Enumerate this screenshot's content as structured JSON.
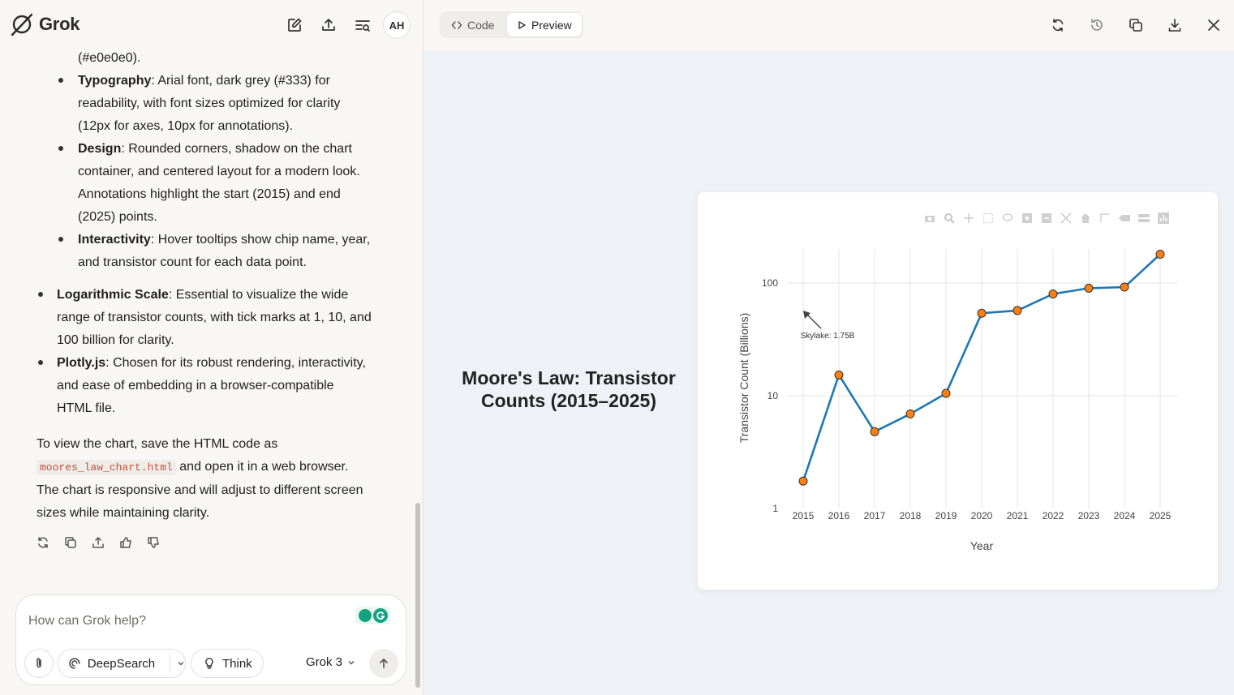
{
  "app": {
    "name": "Grok",
    "avatar_initials": "AH"
  },
  "chat": {
    "partial_top_line": "(#e0e0e0).",
    "sub_bullets": [
      {
        "bold": "Typography",
        "text": ": Arial font, dark grey (#333) for",
        "lines": [
          "readability, with font sizes optimized for clarity",
          "(12px for axes, 10px for annotations)."
        ]
      },
      {
        "bold": "Design",
        "text": ": Rounded corners, shadow on the chart",
        "lines": [
          "container, and centered layout for a modern look.",
          "Annotations highlight the start (2015) and end",
          "(2025) points."
        ]
      },
      {
        "bold": "Interactivity",
        "text": ": Hover tooltips show chip name, year,",
        "lines": [
          "and transistor count for each data point."
        ]
      }
    ],
    "main_bullets": [
      {
        "bold": "Logarithmic Scale",
        "text": ": Essential to visualize the wide",
        "lines": [
          "range of transistor counts, with tick marks at 1, 10, and",
          "100 billion for clarity."
        ]
      },
      {
        "bold": "Plotly.js",
        "text": ": Chosen for its robust rendering, interactivity,",
        "lines": [
          "and ease of embedding in a browser-compatible",
          "HTML file."
        ]
      }
    ],
    "closing": {
      "line1": "To view the chart, save the HTML code as",
      "filename": "moores_law_chart.html",
      "line2_rest": " and open it in a web browser.",
      "line3": "The chart is responsive and will adjust to different screen",
      "line4": "sizes while maintaining clarity."
    }
  },
  "composer": {
    "placeholder": "How can Grok help?",
    "deepsearch_label": "DeepSearch",
    "think_label": "Think",
    "model_label": "Grok 3"
  },
  "preview": {
    "code_tab": "Code",
    "preview_tab": "Preview"
  },
  "chart_data": {
    "type": "line",
    "title": "Moore's Law: Transistor Counts (2015–2025)",
    "xlabel": "Year",
    "ylabel": "Transistor Count (Billions)",
    "yscale": "log",
    "ylim": [
      1,
      200
    ],
    "x": [
      2015,
      2016,
      2017,
      2018,
      2019,
      2020,
      2021,
      2022,
      2023,
      2024,
      2025
    ],
    "values": [
      1.75,
      15.3,
      4.8,
      6.9,
      10.5,
      54,
      57,
      80,
      90,
      92,
      180
    ],
    "y_ticks": [
      {
        "value": 1,
        "label": "1"
      },
      {
        "value": 10,
        "label": "10"
      },
      {
        "value": 100,
        "label": "100"
      }
    ],
    "line_color": "#1f77b4",
    "marker_color": "#ff7f0e",
    "annotation": "Skylake: 1.75B",
    "grid": true
  }
}
